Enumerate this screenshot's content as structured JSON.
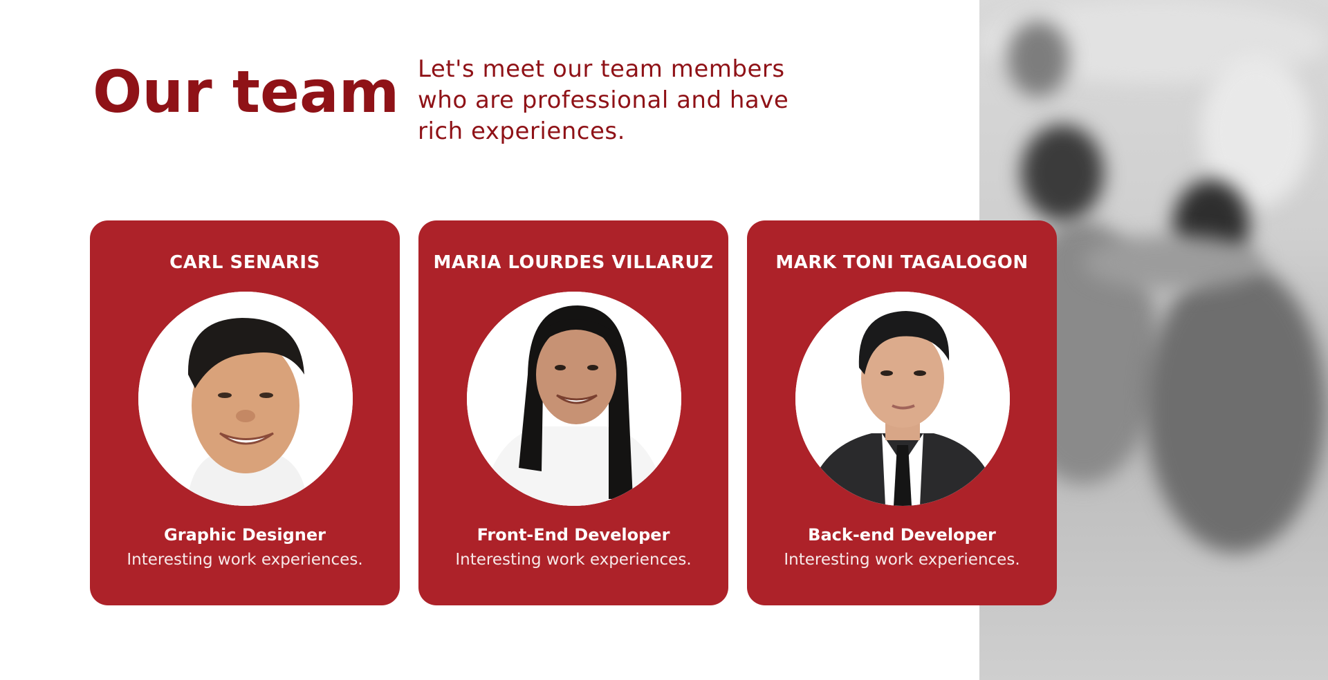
{
  "header": {
    "title": "Our team",
    "subtitle": "Let's meet our team members who are professional and have rich experiences."
  },
  "colors": {
    "brand_red": "#8f1217",
    "card_red": "#ad2229",
    "card_text": "#ffffff"
  },
  "team": [
    {
      "name": "CARL SENARIS",
      "role": "Graphic Designer",
      "description": "Interesting work experiences.",
      "photo": "portrait-photo"
    },
    {
      "name": "MARIA LOURDES VILLARUZ",
      "role": "Front-End Developer",
      "description": "Interesting work experiences.",
      "photo": "portrait-photo"
    },
    {
      "name": "MARK TONI TAGALOGON",
      "role": "Back-end Developer",
      "description": "Interesting work experiences.",
      "photo": "portrait-photo"
    }
  ],
  "background_photo": "blurred-office-photo"
}
